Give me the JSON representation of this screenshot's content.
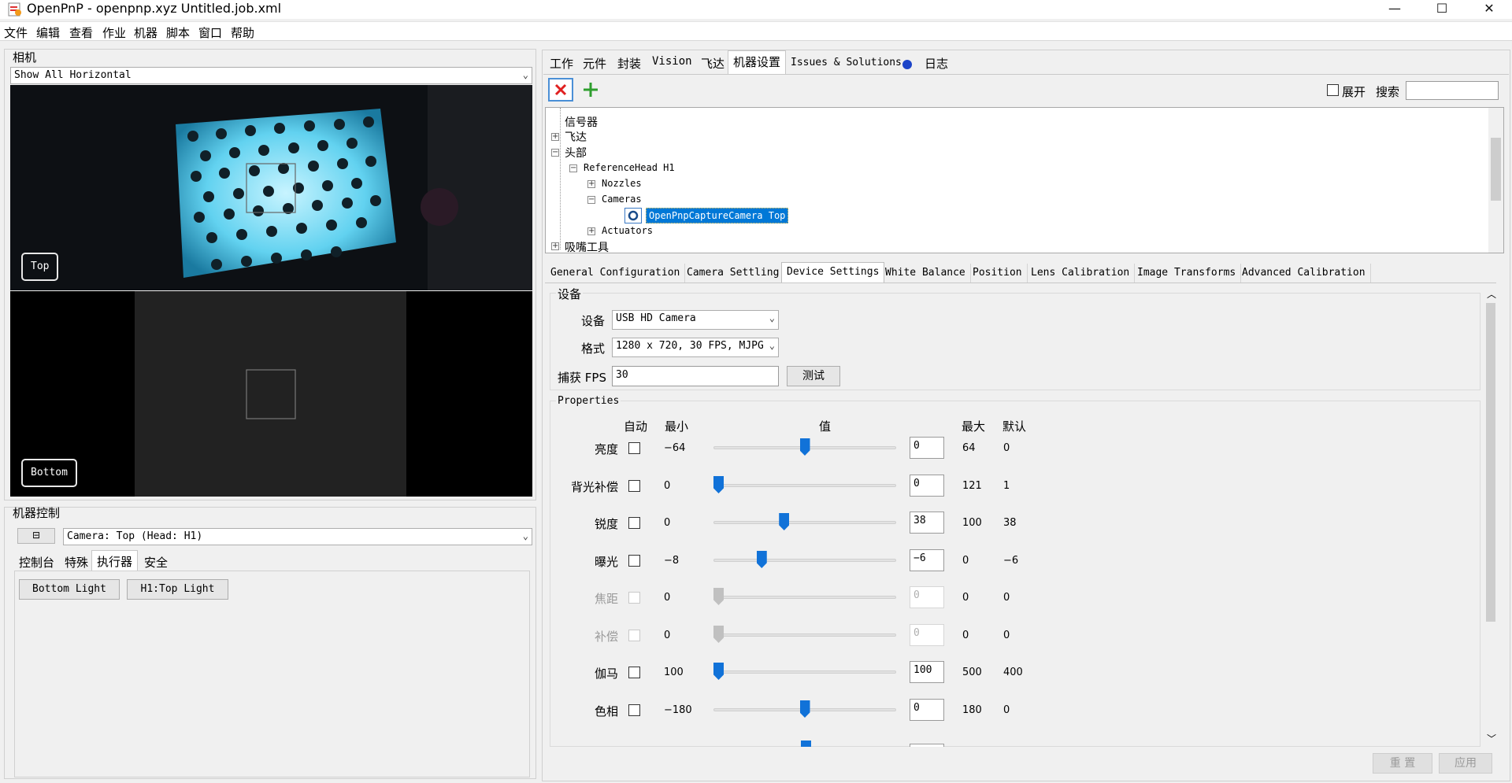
{
  "window": {
    "title": "OpenPnP - openpnp.xyz Untitled.job.xml",
    "minimize": "—",
    "maximize": "☐",
    "close": "✕"
  },
  "menu": [
    "文件",
    "编辑",
    "查看",
    "作业",
    "机器",
    "脚本",
    "窗口",
    "帮助"
  ],
  "camera_panel": {
    "title": "相机",
    "view_mode": "Show All Horizontal",
    "top_label": "Top",
    "bottom_label": "Bottom"
  },
  "machine_control": {
    "title": "机器控制",
    "camera_select": "Camera: Top (Head: H1)",
    "tabs": [
      "控制台",
      "特殊",
      "执行器",
      "安全"
    ],
    "active_tab": "执行器",
    "actuators": [
      "Bottom Light",
      "H1:Top Light"
    ]
  },
  "main_tabs": [
    "工作",
    "元件",
    "封装",
    "Vision",
    "飞达",
    "机器设置",
    "Issues & Solutions",
    "日志"
  ],
  "active_main_tab": "机器设置",
  "toolbar": {
    "expand_label": "展开",
    "search_label": "搜索",
    "search_value": ""
  },
  "tree": {
    "nodes": [
      {
        "label": "信号器",
        "toggle": ""
      },
      {
        "label": "飞达",
        "toggle": "+"
      },
      {
        "label": "头部",
        "toggle": "−"
      },
      {
        "label": "ReferenceHead H1",
        "toggle": "−"
      },
      {
        "label": "Nozzles",
        "toggle": "+"
      },
      {
        "label": "Cameras",
        "toggle": "−"
      },
      {
        "label": "OpenPnpCaptureCamera Top",
        "toggle": ""
      },
      {
        "label": "Actuators",
        "toggle": "+"
      },
      {
        "label": "吸嘴工具",
        "toggle": "+"
      }
    ]
  },
  "settings_tabs": [
    "General Configuration",
    "Camera Settling",
    "Device Settings",
    "White Balance",
    "Position",
    "Lens Calibration",
    "Image Transforms",
    "Advanced Calibration"
  ],
  "active_settings_tab": "Device Settings",
  "device": {
    "group_title": "设备",
    "device_label": "设备",
    "device_value": "USB HD Camera",
    "format_label": "格式",
    "format_value": "1280 x 720, 30 FPS, MJPG",
    "fps_label": "捕获 FPS",
    "fps_value": "30",
    "test_button": "测试"
  },
  "properties": {
    "group_title": "Properties",
    "headers": {
      "auto": "自动",
      "min": "最小",
      "value": "值",
      "max": "最大",
      "default": "默认"
    },
    "rows": [
      {
        "name": "亮度",
        "min": "−64",
        "value": "0",
        "max": "64",
        "default": "0",
        "enabled": true,
        "level": 0.5
      },
      {
        "name": "背光补偿",
        "min": "0",
        "value": "0",
        "max": "121",
        "default": "1",
        "enabled": true,
        "level": 0.0
      },
      {
        "name": "锐度",
        "min": "0",
        "value": "38",
        "max": "100",
        "default": "38",
        "enabled": true,
        "level": 0.38
      },
      {
        "name": "曝光",
        "min": "−8",
        "value": "−6",
        "max": "0",
        "default": "−6",
        "enabled": true,
        "level": 0.25
      },
      {
        "name": "焦距",
        "min": "0",
        "value": "0",
        "max": "0",
        "default": "0",
        "enabled": false,
        "level": 0.0
      },
      {
        "name": "补偿",
        "min": "0",
        "value": "0",
        "max": "0",
        "default": "0",
        "enabled": false,
        "level": 0.0
      },
      {
        "name": "伽马",
        "min": "100",
        "value": "100",
        "max": "500",
        "default": "400",
        "enabled": true,
        "level": 0.0
      },
      {
        "name": "色相",
        "min": "−180",
        "value": "0",
        "max": "180",
        "default": "0",
        "enabled": true,
        "level": 0.5
      }
    ]
  },
  "footer": {
    "reset": "重 置",
    "apply": "应用"
  },
  "colors": {
    "accent": "#1172d8",
    "selection": "#0078d7",
    "delete": "#e02020",
    "add": "#2e9e2e"
  }
}
